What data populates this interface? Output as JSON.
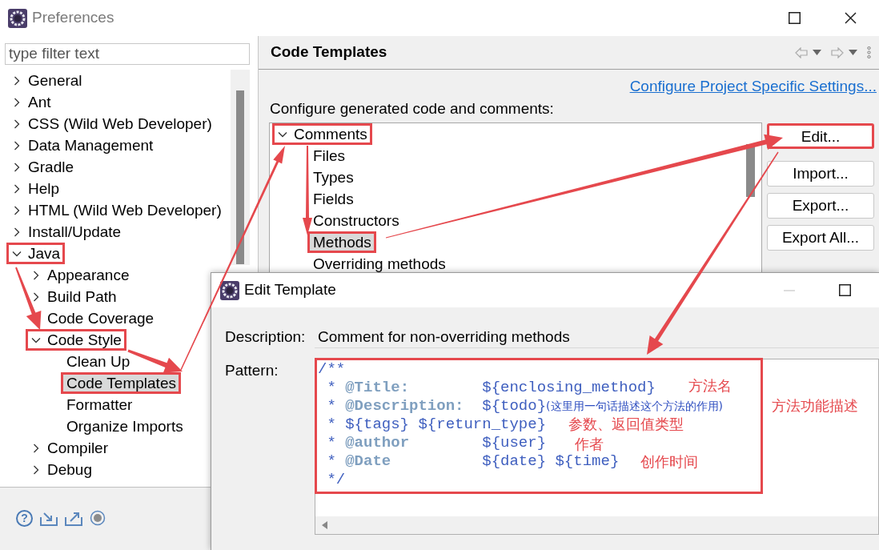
{
  "window": {
    "title": "Preferences"
  },
  "filter": {
    "placeholder": "type filter text"
  },
  "nav_tree": [
    {
      "label": "General",
      "expanded": false,
      "selected": false,
      "marked": false
    },
    {
      "label": "Ant",
      "expanded": false,
      "selected": false,
      "marked": false
    },
    {
      "label": "CSS (Wild Web Developer)",
      "expanded": false,
      "selected": false,
      "marked": false
    },
    {
      "label": "Data Management",
      "expanded": false,
      "selected": false,
      "marked": false
    },
    {
      "label": "Gradle",
      "expanded": false,
      "selected": false,
      "marked": false
    },
    {
      "label": "Help",
      "expanded": false,
      "selected": false,
      "marked": false
    },
    {
      "label": "HTML (Wild Web Developer)",
      "expanded": false,
      "selected": false,
      "marked": false
    },
    {
      "label": "Install/Update",
      "expanded": false,
      "selected": false,
      "marked": false
    },
    {
      "label": "Java",
      "expanded": true,
      "selected": false,
      "marked": true,
      "children": [
        {
          "label": "Appearance",
          "expanded": false,
          "selected": false,
          "marked": false
        },
        {
          "label": "Build Path",
          "expanded": false,
          "selected": false,
          "marked": false
        },
        {
          "label": "Code Coverage",
          "selected": false,
          "marked": false
        },
        {
          "label": "Code Style",
          "expanded": true,
          "selected": false,
          "marked": true,
          "children": [
            {
              "label": "Clean Up",
              "selected": false,
              "marked": false
            },
            {
              "label": "Code Templates",
              "selected": true,
              "marked": true
            },
            {
              "label": "Formatter",
              "selected": false,
              "marked": false
            },
            {
              "label": "Organize Imports",
              "selected": false,
              "marked": false
            }
          ]
        },
        {
          "label": "Compiler",
          "expanded": false,
          "selected": false,
          "marked": false
        },
        {
          "label": "Debug",
          "expanded": false,
          "selected": false,
          "marked": false
        }
      ]
    }
  ],
  "footer": {
    "help": "?"
  },
  "page": {
    "title": "Code Templates",
    "link": "Configure Project Specific Settings...",
    "description": "Configure generated code and comments:",
    "template_tree": [
      {
        "label": "Comments",
        "expanded": true,
        "selected": false,
        "marked": true,
        "children": [
          {
            "label": "Files",
            "selected": false,
            "marked": false
          },
          {
            "label": "Types",
            "selected": false,
            "marked": false
          },
          {
            "label": "Fields",
            "selected": false,
            "marked": false
          },
          {
            "label": "Constructors",
            "selected": false,
            "marked": false
          },
          {
            "label": "Methods",
            "selected": true,
            "marked": true
          },
          {
            "label": "Overriding methods",
            "selected": false,
            "marked": false
          }
        ]
      }
    ],
    "buttons": [
      {
        "label": "Edit...",
        "marked": true
      },
      {
        "label": "Import...",
        "marked": false
      },
      {
        "label": "Export...",
        "marked": false
      },
      {
        "label": "Export All...",
        "marked": false
      }
    ]
  },
  "dialog": {
    "title": "Edit Template",
    "description_label": "Description:",
    "description": "Comment for non-overriding methods",
    "pattern_label": "Pattern:",
    "pattern": {
      "marked": true,
      "lines": [
        [
          {
            "kind": "plain",
            "text": "/**"
          }
        ],
        [
          {
            "kind": "plain",
            "text": " * "
          },
          {
            "kind": "tag",
            "text": "@Title:"
          },
          {
            "kind": "plain",
            "text": "        ${enclosing_method}"
          }
        ],
        [
          {
            "kind": "plain",
            "text": " * "
          },
          {
            "kind": "tag",
            "text": "@Description:"
          },
          {
            "kind": "plain",
            "text": "  ${todo}"
          },
          {
            "kind": "note",
            "text": "(这里用一句话描述这个方法的作用)"
          }
        ],
        [
          {
            "kind": "plain",
            "text": " * ${tags} ${return_type}"
          }
        ],
        [
          {
            "kind": "plain",
            "text": " * "
          },
          {
            "kind": "tag",
            "text": "@author"
          },
          {
            "kind": "plain",
            "text": "        ${user}"
          }
        ],
        [
          {
            "kind": "plain",
            "text": " * "
          },
          {
            "kind": "tag",
            "text": "@Date"
          },
          {
            "kind": "plain",
            "text": "          ${date} ${time}"
          }
        ],
        [
          {
            "kind": "plain",
            "text": " */"
          }
        ]
      ]
    }
  },
  "annotations": [
    {
      "text": "方法名"
    },
    {
      "text": "方法功能描述"
    },
    {
      "text": "参数、返回值类型"
    },
    {
      "text": "作者"
    },
    {
      "text": "创作时间"
    }
  ]
}
